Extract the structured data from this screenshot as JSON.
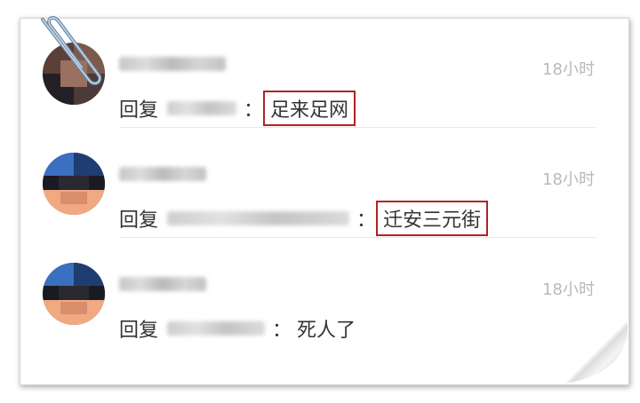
{
  "comments": [
    {
      "time": "18小时",
      "reply_label": "回复",
      "colon": "：",
      "text": "足来足网",
      "highlighted": true
    },
    {
      "time": "18小时",
      "reply_label": "回复",
      "colon": "：",
      "text": "迁安三元街",
      "highlighted": true
    },
    {
      "time": "18小时",
      "reply_label": "回复",
      "colon": "：",
      "text": "死人了",
      "highlighted": false
    }
  ],
  "colors": {
    "highlight_border": "#b22222",
    "time_text": "#b9b9b9",
    "body_text": "#333333"
  },
  "icons": {
    "paperclip": "paperclip-icon"
  }
}
